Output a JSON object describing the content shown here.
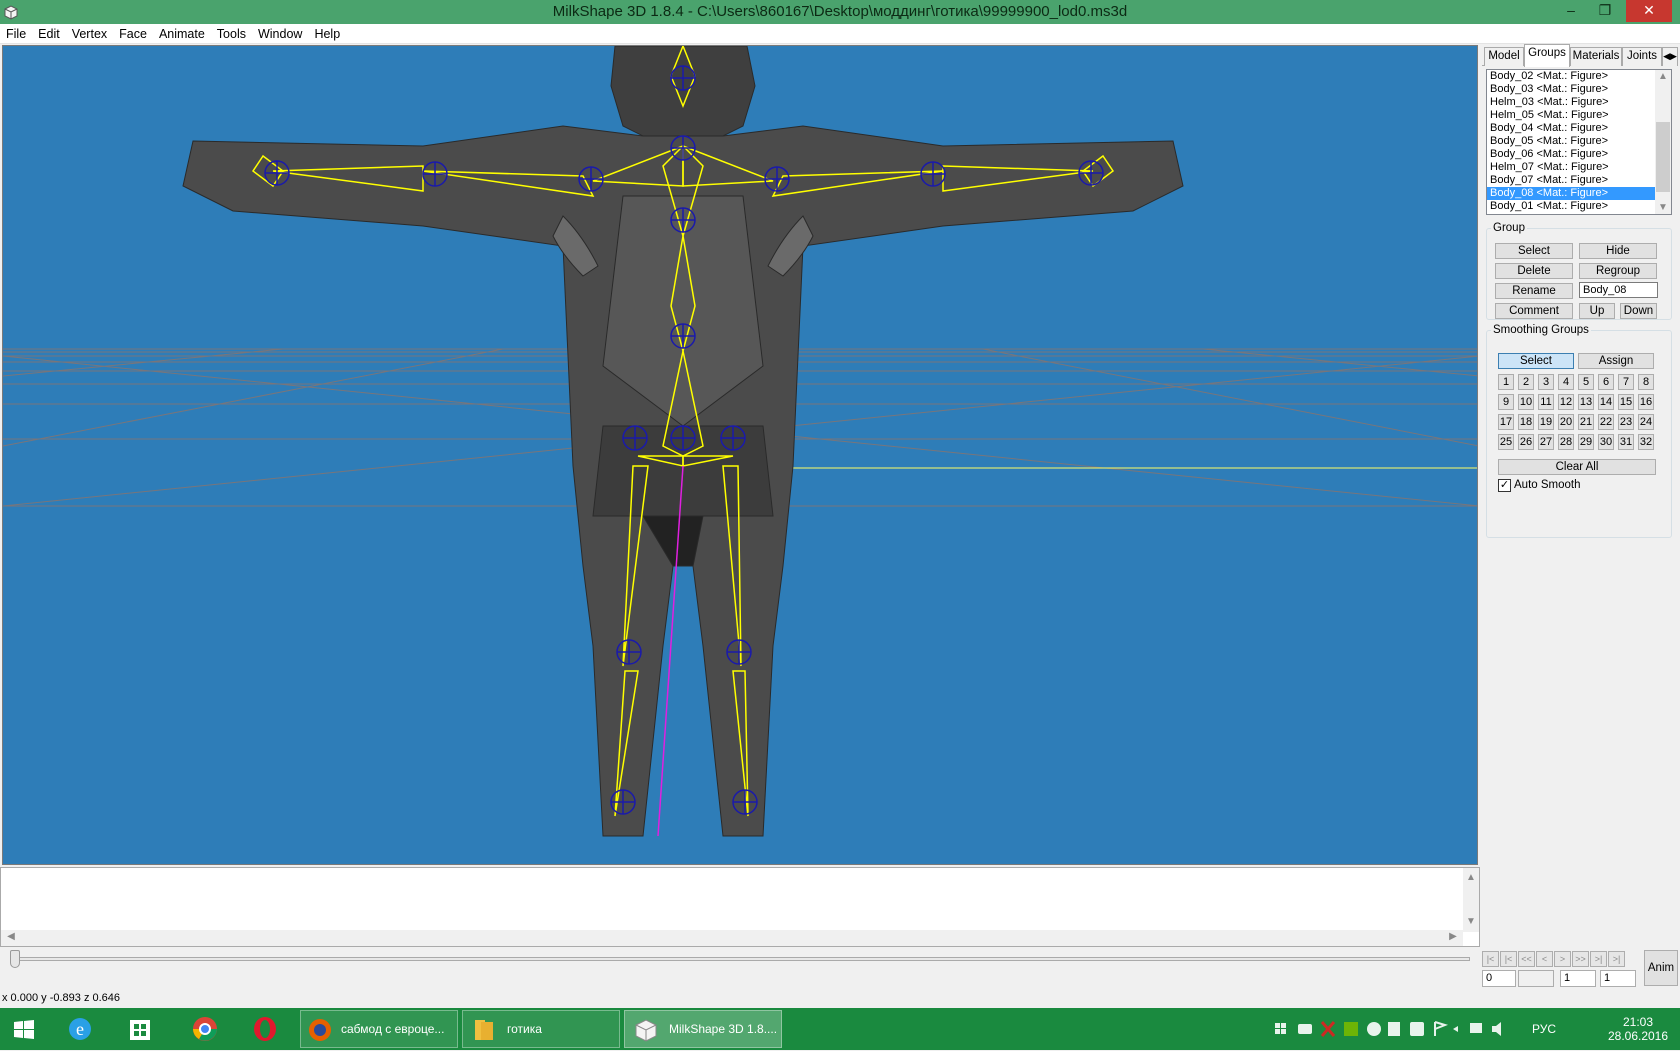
{
  "window": {
    "title": "MilkShape 3D 1.8.4 - C:\\Users\\860167\\Desktop\\моддинг\\готика\\99999900_lod0.ms3d",
    "minimize": "–",
    "maximize": "❐",
    "close": "✕"
  },
  "menu": [
    "File",
    "Edit",
    "Vertex",
    "Face",
    "Animate",
    "Tools",
    "Window",
    "Help"
  ],
  "tabs": [
    "Model",
    "Groups",
    "Materials",
    "Joints"
  ],
  "groups_list": [
    "Body_02  <Mat.: Figure>",
    "Body_03  <Mat.: Figure>",
    "Helm_03  <Mat.: Figure>",
    "Helm_05 <Mat.: Figure>",
    "Body_04 <Mat.: Figure>",
    "Body_05 <Mat.: Figure>",
    "Body_06 <Mat.: Figure>",
    "Helm_07 <Mat.: Figure>",
    "Body_07 <Mat.: Figure>",
    "Body_08 <Mat.: Figure>",
    "Body_01 <Mat.: Figure>"
  ],
  "group_panel": {
    "legend": "Group",
    "select": "Select",
    "hide": "Hide",
    "delete": "Delete",
    "regroup": "Regroup",
    "rename": "Rename",
    "name_value": "Body_08",
    "comment": "Comment",
    "up": "Up",
    "down": "Down"
  },
  "smoothing": {
    "legend": "Smoothing Groups",
    "select": "Select",
    "assign": "Assign",
    "numbers": [
      "1",
      "2",
      "3",
      "4",
      "5",
      "6",
      "7",
      "8",
      "9",
      "10",
      "11",
      "12",
      "13",
      "14",
      "15",
      "16",
      "17",
      "18",
      "19",
      "20",
      "21",
      "22",
      "23",
      "24",
      "25",
      "26",
      "27",
      "28",
      "29",
      "30",
      "31",
      "32"
    ],
    "clear_all": "Clear All",
    "auto_smooth": "Auto Smooth",
    "auto_smooth_checked": true
  },
  "anim": {
    "buttons": [
      "|<",
      "|<",
      "<<",
      "<",
      ">",
      ">>",
      ">|",
      ">|"
    ],
    "anim_label": "Anim",
    "frame": "0",
    "start": "1",
    "end": "1"
  },
  "status": {
    "coords": "x 0.000 y -0.893 z 0.646"
  },
  "taskbar": {
    "task_firefox": "сабмод с евроце...",
    "task_folder": "готика",
    "task_milkshape": "MilkShape 3D 1.8....",
    "lang": "РУС",
    "time": "21:03",
    "date": "28.06.2016"
  },
  "colors": {
    "viewport_bg": "#2e7db8",
    "bone": "#ffff00",
    "joint": "#1a1aaa",
    "taskbar": "#1a8a3f",
    "selection": "#3399ff"
  }
}
